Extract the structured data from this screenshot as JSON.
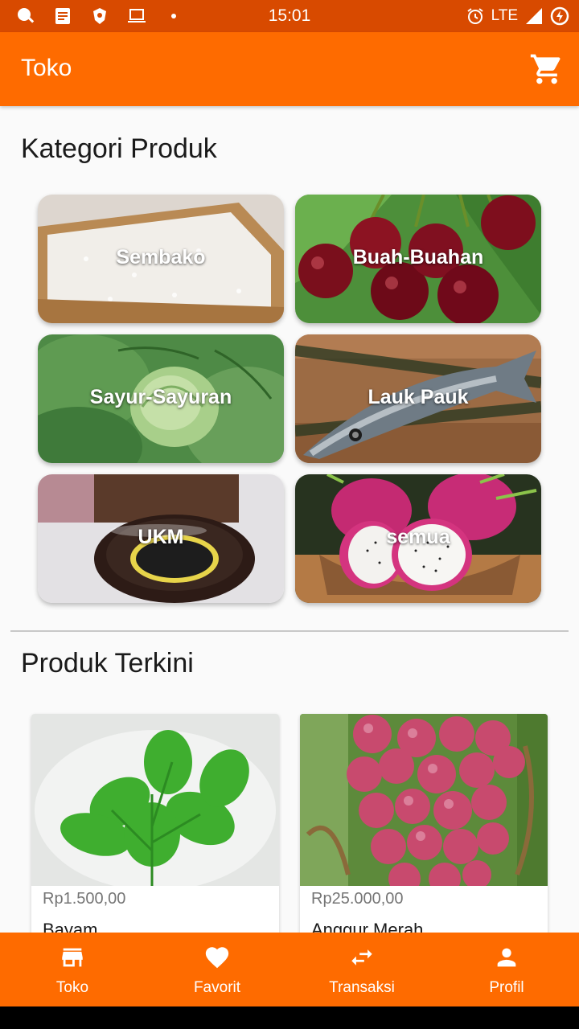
{
  "status": {
    "time": "15:01",
    "network": "LTE"
  },
  "appbar": {
    "title": "Toko",
    "cart_icon": "shopping-cart-icon"
  },
  "categories": {
    "title": "Kategori Produk",
    "items": [
      {
        "label": "Sembako",
        "image": "rice"
      },
      {
        "label": "Buah-Buahan",
        "image": "cherries"
      },
      {
        "label": "Sayur-Sayuran",
        "image": "cabbage"
      },
      {
        "label": "Lauk Pauk",
        "image": "fish"
      },
      {
        "label": "UKM",
        "image": "snack-package"
      },
      {
        "label": "semua",
        "image": "dragon-fruit"
      }
    ]
  },
  "products": {
    "title": "Produk Terkini",
    "items": [
      {
        "price": "Rp1.500,00",
        "name": "Bayam",
        "image": "spinach"
      },
      {
        "price": "Rp25.000,00",
        "name": "Anggur Merah",
        "image": "red-grapes"
      }
    ]
  },
  "bottom_nav": {
    "items": [
      {
        "label": "Toko",
        "icon": "store-icon"
      },
      {
        "label": "Favorit",
        "icon": "heart-icon"
      },
      {
        "label": "Transaksi",
        "icon": "swap-arrows-icon"
      },
      {
        "label": "Profil",
        "icon": "person-icon"
      }
    ]
  },
  "colors": {
    "primary": "#fe6b00",
    "status_bar": "#d84a00",
    "background": "#fafafa"
  }
}
